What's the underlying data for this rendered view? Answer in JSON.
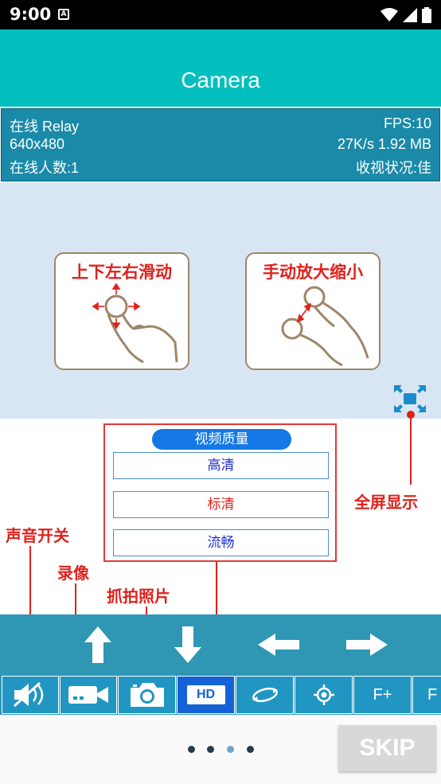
{
  "status_bar": {
    "time": "9:00",
    "notification_glyph": "A"
  },
  "app_bar": {
    "title": "Camera"
  },
  "info": {
    "status": "在线  Relay",
    "fps": "FPS:10",
    "resolution": "640x480",
    "bitrate": "27K/s 1.92 MB",
    "viewers": "在线人数:1",
    "quality_status": "收视状况:佳"
  },
  "gestures": {
    "swipe_label": "上下左右滑动",
    "pinch_label": "手动放大缩小"
  },
  "quality_menu": {
    "title": "视频质量",
    "options": [
      {
        "label": "高清",
        "color": "#1a2fd0"
      },
      {
        "label": "标清",
        "color": "#e0211b"
      },
      {
        "label": "流畅",
        "color": "#1a2fd0"
      }
    ]
  },
  "annotations": {
    "fullscreen": "全屏显示",
    "sound": "声音开关",
    "record": "录像",
    "snapshot": "抓拍照片"
  },
  "controls": {
    "buttons": [
      {
        "icon": "mute-icon"
      },
      {
        "icon": "video-record-icon"
      },
      {
        "icon": "camera-icon"
      },
      {
        "icon": "hd-icon",
        "label": "HD",
        "active": true
      },
      {
        "icon": "rotate-icon"
      },
      {
        "icon": "target-icon"
      },
      {
        "icon": "focus-plus",
        "label": "F+"
      },
      {
        "icon": "focus",
        "label": "F"
      }
    ]
  },
  "pager": {
    "count": 4,
    "active_index": 2
  },
  "skip": {
    "label": "SKIP"
  },
  "colors": {
    "app_bar": "#00bfbe",
    "info_panel": "#1a8aa8",
    "accent_red": "#e0211b",
    "control_panel": "#2f96b4",
    "active_button": "#1462d6"
  }
}
